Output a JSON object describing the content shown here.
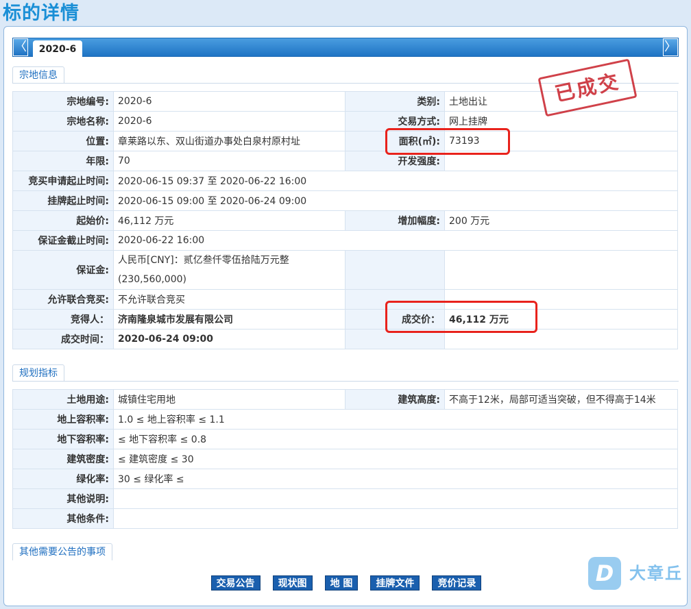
{
  "page_title": "标的详情",
  "tab": {
    "prev_icon": "arrow-left-icon",
    "next_icon": "arrow-right-icon",
    "prev_glyph": "〈",
    "next_glyph": "〉",
    "active": "2020-6"
  },
  "sections": {
    "parcel": "宗地信息",
    "planning": "规划指标",
    "other": "其他需要公告的事项"
  },
  "stamp": "已成交",
  "parcel": {
    "code_label": "宗地编号:",
    "code": "2020-6",
    "type_label": "类别:",
    "type": "土地出让",
    "name_label": "宗地名称:",
    "name": "2020-6",
    "method_label": "交易方式:",
    "method": "网上挂牌",
    "location_label": "位置:",
    "location": "章莱路以东、双山街道办事处白泉村原村址",
    "area_label": "面积(㎡):",
    "area": "73193",
    "term_label": "年限:",
    "term": "70",
    "intensity_label": "开发强度:",
    "intensity": "",
    "apply_label": "竞买申请起止时间:",
    "apply": "2020-06-15 09:37 至 2020-06-22 16:00",
    "listing_label": "挂牌起止时间:",
    "listing": "2020-06-15 09:00 至 2020-06-24 09:00",
    "start_price_label": "起始价:",
    "start_price": "46,112 万元",
    "increment_label": "增加幅度:",
    "increment": "200 万元",
    "deposit_deadline_label": "保证金截止时间:",
    "deposit_deadline": "2020-06-22 16:00",
    "deposit_label": "保证金:",
    "deposit_line1": "人民币[CNY]：贰亿叁仟零伍拾陆万元整",
    "deposit_line2": "(230,560,000)",
    "joint_label": "允许联合竞买:",
    "joint": "不允许联合竞买",
    "winner_label": "竞得人：",
    "winner": "济南隆泉城市发展有限公司",
    "deal_price_label": "成交价：",
    "deal_price": "46,112 万元",
    "deal_time_label": "成交时间：",
    "deal_time": "2020-06-24 09:00"
  },
  "planning": {
    "use_label": "土地用途:",
    "use": "城镇住宅用地",
    "height_label": "建筑高度:",
    "height": "不高于12米，局部可适当突破，但不得高于14米",
    "far_above_label": "地上容积率:",
    "far_above": "1.0 ≤ 地上容积率 ≤ 1.1",
    "far_below_label": "地下容积率:",
    "far_below": "≤ 地下容积率 ≤ 0.8",
    "density_label": "建筑密度:",
    "density": "≤ 建筑密度 ≤ 30",
    "green_label": "绿化率:",
    "green": "30 ≤ 绿化率 ≤",
    "notes_label": "其他说明:",
    "notes": "",
    "conditions_label": "其他条件:",
    "conditions": ""
  },
  "buttons": [
    "交易公告",
    "现状图",
    "地 图",
    "挂牌文件",
    "竞价记录"
  ],
  "watermark": {
    "logo_letter": "D",
    "text": "大章丘"
  },
  "colors": {
    "accent": "#1a8fd6",
    "tab_bar": "#1f74c4",
    "highlight_box": "#e8221c",
    "stamp": "#c8202a",
    "button": "#1a5fae"
  }
}
